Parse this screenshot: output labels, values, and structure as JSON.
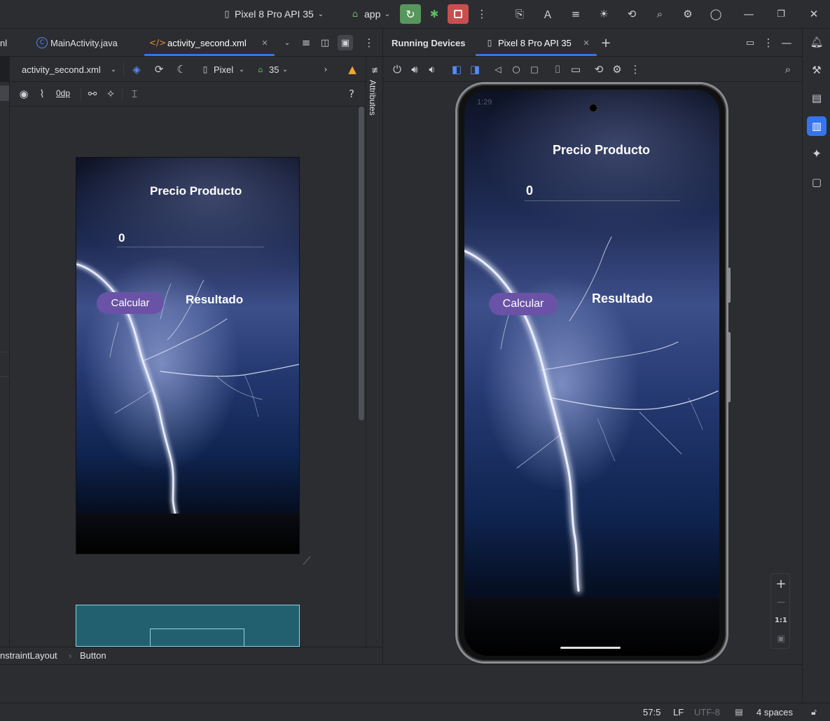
{
  "topbar": {
    "device_selector": "Pixel 8 Pro API 35",
    "run_config": "app"
  },
  "editor_tabs": [
    {
      "label": "nl"
    },
    {
      "label": "MainActivity.java"
    },
    {
      "label": "activity_second.xml"
    }
  ],
  "running_devices": {
    "title": "Running Devices",
    "device_tab": "Pixel 8 Pro API 35"
  },
  "designer": {
    "file_dropdown": "activity_second.xml",
    "device": "Pixel",
    "api": "35",
    "margin": "0dp",
    "attributes_label": "Attributes"
  },
  "app_screen": {
    "title": "Precio Producto",
    "input_value": "0",
    "button_label": "Calcular",
    "result_label": "Resultado"
  },
  "phone_status": {
    "time": "1:29"
  },
  "zoom": {
    "plus": "+",
    "minus": "—",
    "one_to_one": "1:1"
  },
  "breadcrumb": {
    "items": [
      "nstraintLayout",
      "Button"
    ]
  },
  "status": {
    "position": "57:5",
    "line_sep": "LF",
    "encoding": "UTF-8",
    "indent": "4 spaces"
  },
  "colors": {
    "accent": "#3574f0",
    "run_green": "#57965c",
    "stop_red": "#c94f4f",
    "button_purple": "#6a52a6"
  }
}
